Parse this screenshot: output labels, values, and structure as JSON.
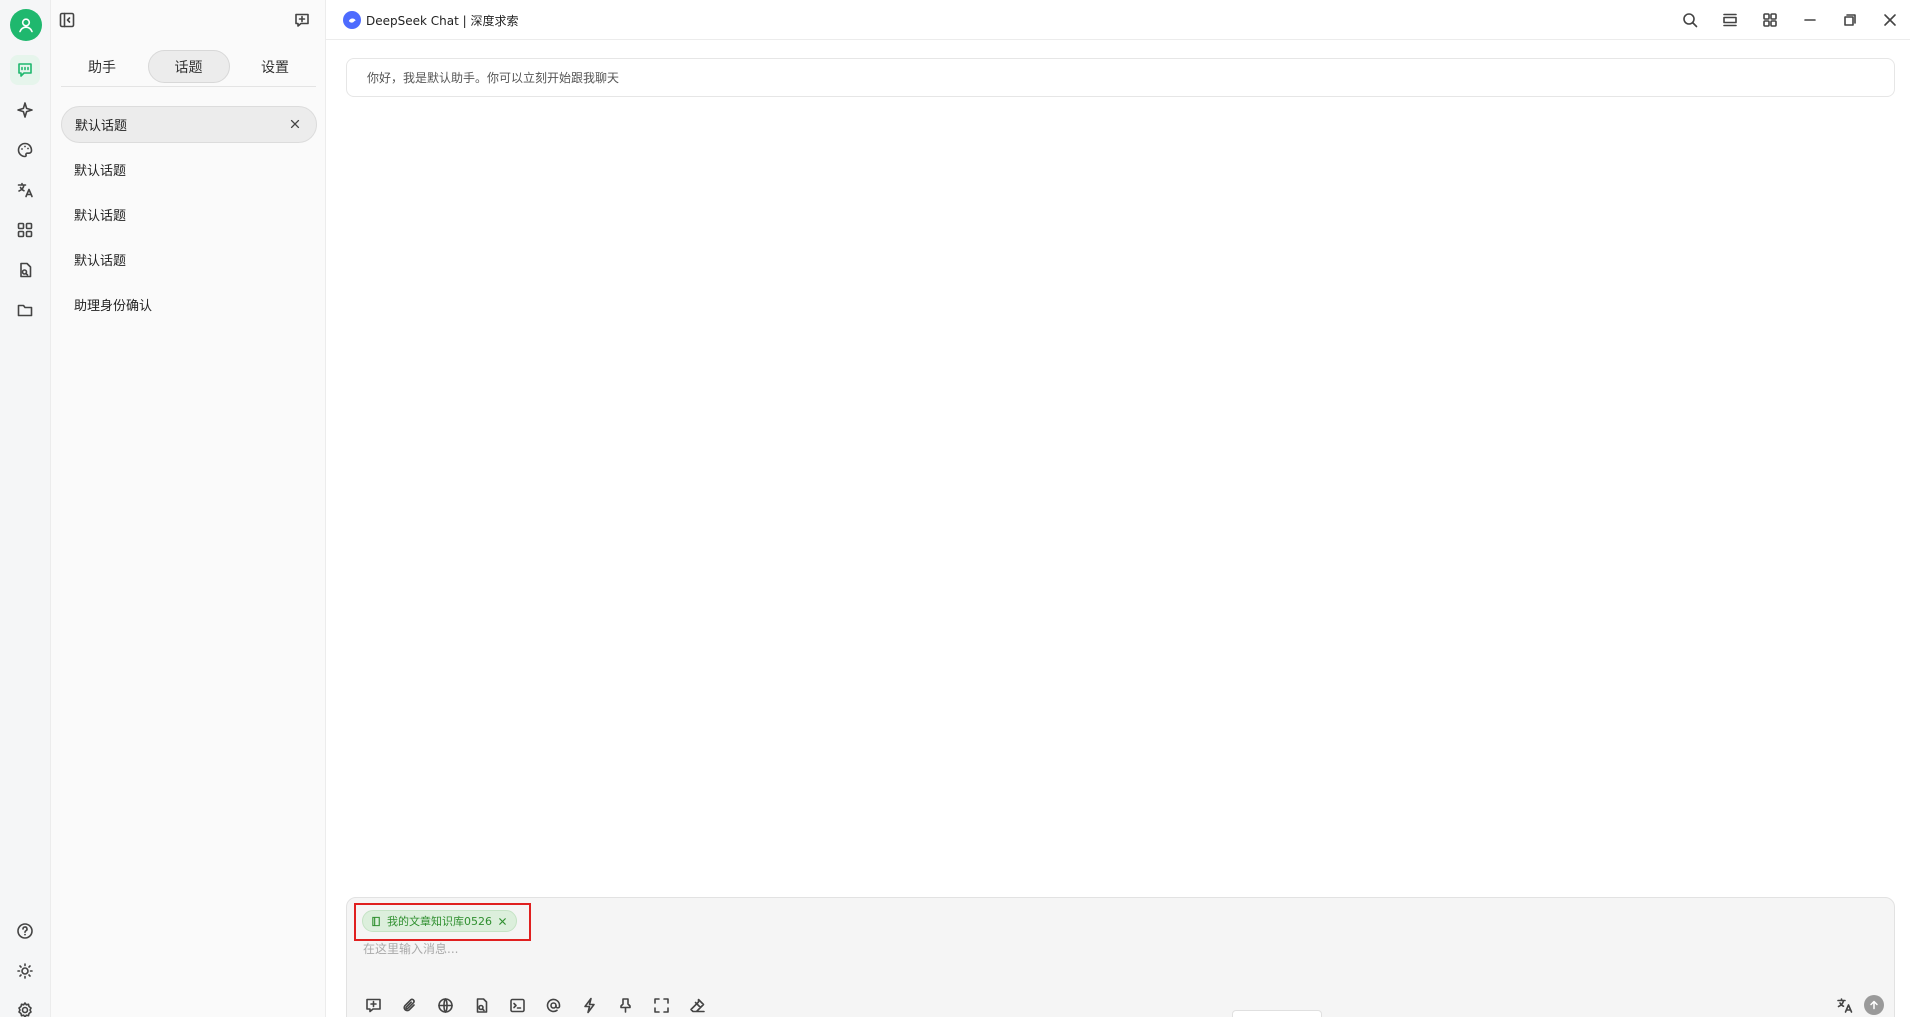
{
  "app": {
    "title": "DeepSeek Chat | 深度求索",
    "brand_color": "#1fb86e",
    "logo_color": "#4d6bfe"
  },
  "sidebar": {
    "items": [
      {
        "icon": "chat-icon",
        "active": true
      },
      {
        "icon": "sparkle-icon"
      },
      {
        "icon": "palette-icon"
      },
      {
        "icon": "translate-icon"
      },
      {
        "icon": "apps-grid-icon"
      },
      {
        "icon": "file-search-icon"
      },
      {
        "icon": "folder-icon"
      }
    ],
    "bottom_items": [
      {
        "icon": "help-icon"
      },
      {
        "icon": "sun-icon"
      },
      {
        "icon": "settings-gear-icon"
      }
    ]
  },
  "panel": {
    "tabs": [
      {
        "label": "助手",
        "active": false
      },
      {
        "label": "话题",
        "active": true
      },
      {
        "label": "设置",
        "active": false
      }
    ],
    "topics": [
      {
        "label": "默认话题",
        "active": true
      },
      {
        "label": "默认话题",
        "active": false
      },
      {
        "label": "默认话题",
        "active": false
      },
      {
        "label": "默认话题",
        "active": false
      },
      {
        "label": "助理身份确认",
        "active": false
      }
    ]
  },
  "chat": {
    "greeting": "你好，我是默认助手。你可以立刻开始跟我聊天"
  },
  "composer": {
    "knowledge_chip": "我的文章知识库0526",
    "placeholder": "在这里输入消息...",
    "highlight_color": "#e02020",
    "tools": [
      "new-topic-icon",
      "paperclip-icon",
      "globe-icon",
      "file-search-icon",
      "terminal-icon",
      "at-icon",
      "lightning-icon",
      "pin-icon",
      "expand-icon",
      "eraser-icon"
    ]
  }
}
